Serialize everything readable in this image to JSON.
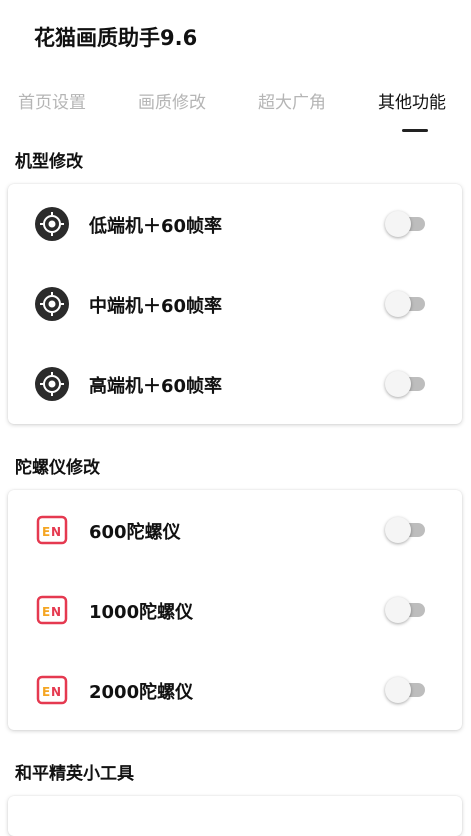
{
  "app": {
    "title": "花猫画质助手9.6"
  },
  "tabs": [
    {
      "label": "首页设置",
      "active": false
    },
    {
      "label": "画质修改",
      "active": false
    },
    {
      "label": "超大广角",
      "active": false
    },
    {
      "label": "其他功能",
      "active": true
    }
  ],
  "sections": {
    "model": {
      "title": "机型修改",
      "items": [
        {
          "label": "低端机＋60帧率",
          "icon": "cpu-chip-icon",
          "checked": false
        },
        {
          "label": "中端机＋60帧率",
          "icon": "cpu-chip-icon",
          "checked": false
        },
        {
          "label": "高端机＋60帧率",
          "icon": "cpu-chip-icon",
          "checked": false
        }
      ]
    },
    "gyro": {
      "title": "陀螺仪修改",
      "items": [
        {
          "label": "600陀螺仪",
          "icon": "en-badge-icon",
          "checked": false
        },
        {
          "label": "1000陀螺仪",
          "icon": "en-badge-icon",
          "checked": false
        },
        {
          "label": "2000陀螺仪",
          "icon": "en-badge-icon",
          "checked": false
        }
      ]
    },
    "tools": {
      "title": "和平精英小工具"
    }
  },
  "colors": {
    "en_icon_orange": "#f5a623",
    "en_icon_red": "#e53950",
    "chip_icon": "#2b2b2b",
    "switch_track": "#bdbdbd",
    "switch_thumb": "#f5f5f5"
  }
}
